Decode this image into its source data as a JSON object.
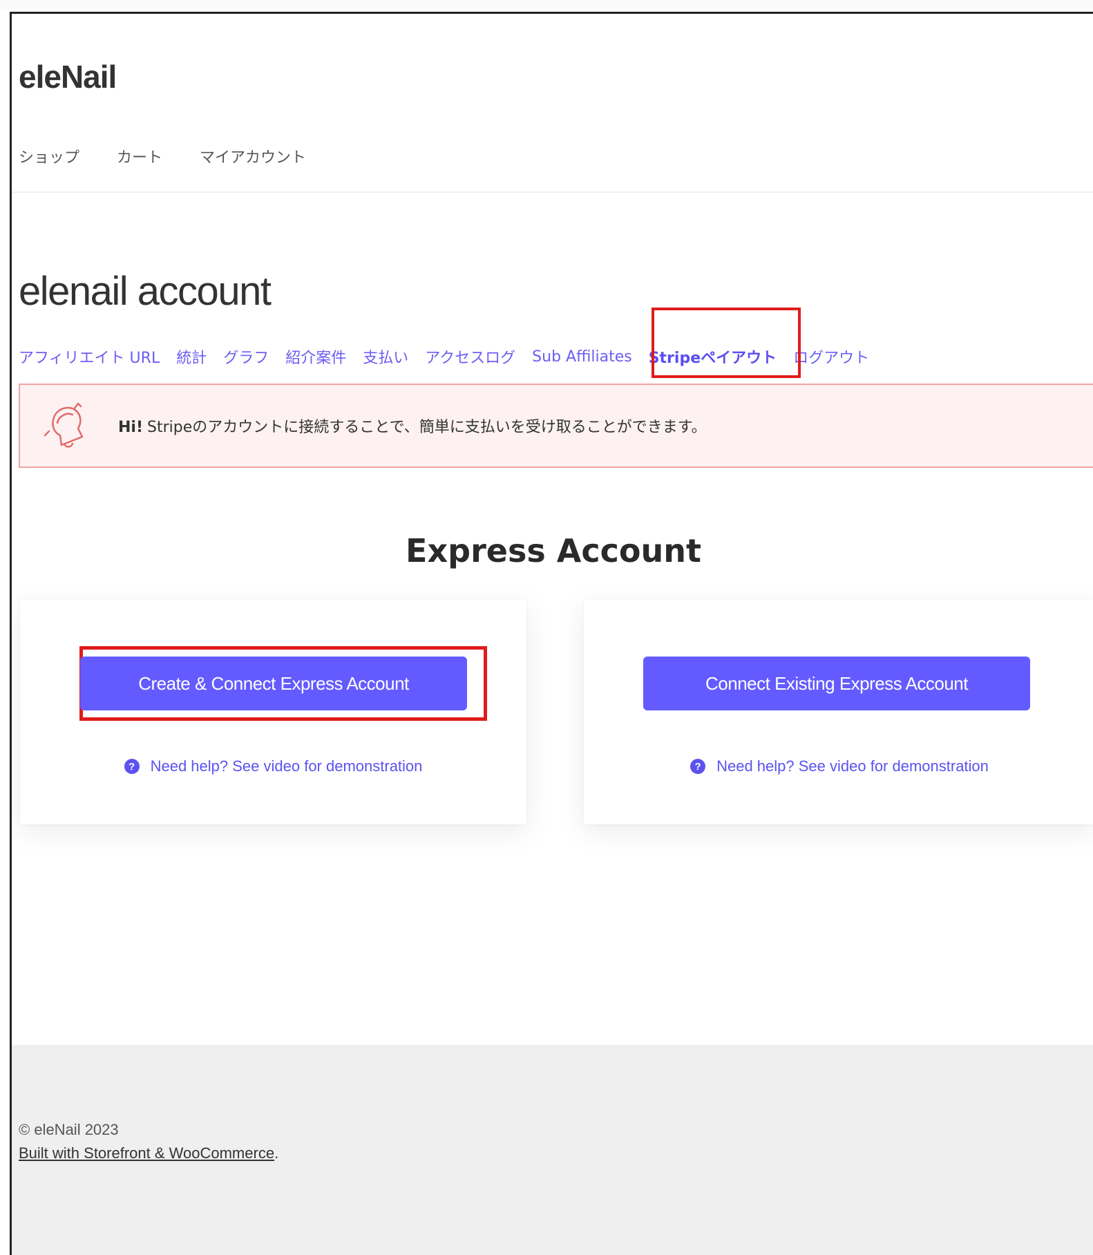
{
  "site": {
    "title": "eleNail",
    "nav": [
      "ショップ",
      "カート",
      "マイアカウント"
    ]
  },
  "page": {
    "title": "elenail account"
  },
  "tabs": [
    {
      "label": "アフィリエイト URL"
    },
    {
      "label": "統計"
    },
    {
      "label": "グラフ"
    },
    {
      "label": "紹介案件"
    },
    {
      "label": "支払い"
    },
    {
      "label": "アクセスログ"
    },
    {
      "label": "Sub Affiliates"
    },
    {
      "label": "Stripeペイアウト",
      "active": true
    },
    {
      "label": "ログアウト"
    }
  ],
  "notice": {
    "greeting": "Hi!",
    "message": "Stripeのアカウントに接続することで、簡単に支払いを受け取ることができます。",
    "icon": "bell-icon"
  },
  "express": {
    "title": "Express Account",
    "create_button": "Create & Connect Express Account",
    "connect_button": "Connect Existing Express Account",
    "help_text": "Need help? See video for demonstration",
    "help_icon_glyph": "?"
  },
  "footer": {
    "copyright": "© eleNail 2023",
    "built_link": "Built with Storefront & WooCommerce",
    "built_suffix": "."
  },
  "colors": {
    "accent": "#635bff",
    "highlight": "#e01b1b",
    "notice_bg": "#fdf1f1",
    "notice_border": "#f2a2a2"
  }
}
